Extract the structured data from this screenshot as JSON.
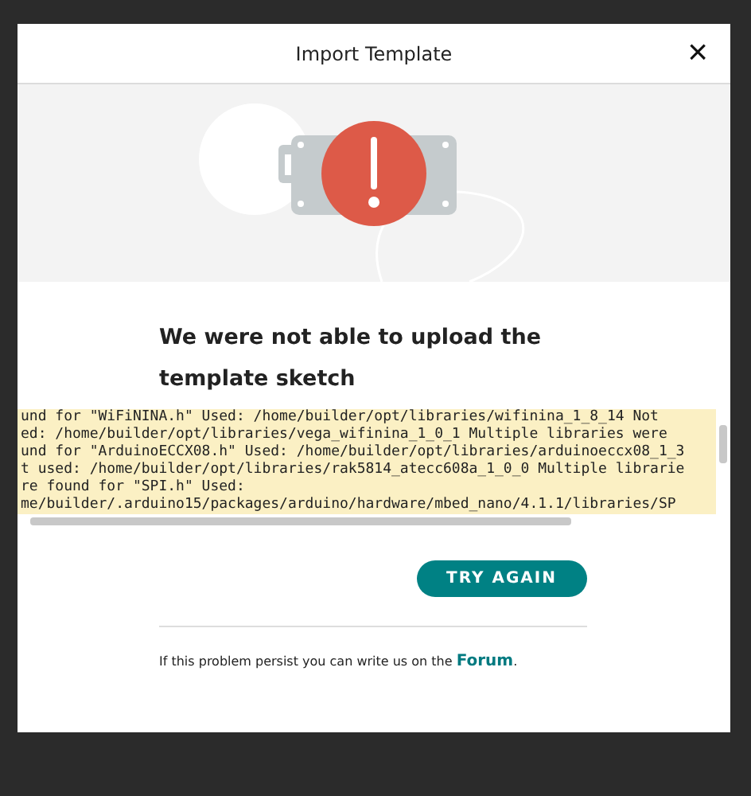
{
  "dialog": {
    "title": "Import Template",
    "close": "×"
  },
  "message": {
    "heading": "We were not able to upload the template sketch"
  },
  "log": {
    "lines": [
      "und for \"WiFiNINA.h\" Used: /home/builder/opt/libraries/wifinina_1_8_14 Not",
      "ed: /home/builder/opt/libraries/vega_wifinina_1_0_1 Multiple libraries were",
      "und for \"ArduinoECCX08.h\" Used: /home/builder/opt/libraries/arduinoeccx08_1_3",
      "t used: /home/builder/opt/libraries/rak5814_atecc608a_1_0_0 Multiple librarie",
      "re found for \"SPI.h\" Used:",
      "me/builder/.arduino15/packages/arduino/hardware/mbed_nano/4.1.1/libraries/SP"
    ]
  },
  "button": {
    "label": "TRY AGAIN"
  },
  "footer": {
    "text": "If this problem persist you can write us on the",
    "link": "Forum",
    "after": "."
  }
}
